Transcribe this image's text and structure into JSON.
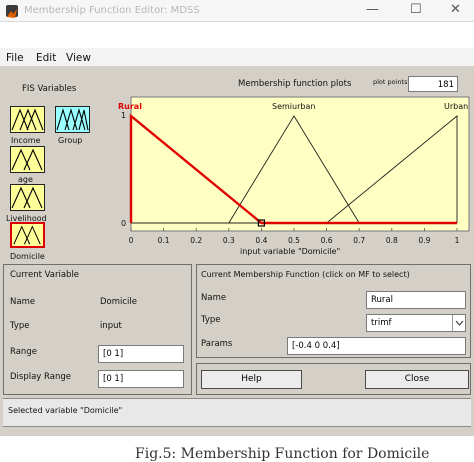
{
  "window": {
    "title": "Membership Function Editor: MDSS",
    "minimize_glyph": "—",
    "maximize_glyph": "☐",
    "close_glyph": "✕"
  },
  "menu": {
    "file": "File",
    "edit": "Edit",
    "view": "View"
  },
  "fis_variables": {
    "heading": "FIS Variables",
    "inputs": [
      "Income",
      "age",
      "Livelihood",
      "Domicile"
    ],
    "output": "Group"
  },
  "plot": {
    "heading": "Membership function plots",
    "plot_points_label": "plot points",
    "plot_points_value": "181",
    "xlabel": "input variable \"Domicile\"",
    "y_top_label": "1",
    "y_bottom_label": "0",
    "x_tick_labels": [
      "0",
      "0.1",
      "0.2",
      "0.3",
      "0.4",
      "0.5",
      "0.6",
      "0.7",
      "0.8",
      "0.9",
      "1"
    ]
  },
  "chart_data": {
    "type": "line",
    "xlabel": "input variable \"Domicile\"",
    "xlim": [
      0,
      1
    ],
    "ylim": [
      0,
      1
    ],
    "grid": false,
    "series": [
      {
        "name": "Rural",
        "x": [
          0,
          0,
          0.4,
          1
        ],
        "y": [
          0,
          1,
          0,
          0
        ],
        "color": "#e00000",
        "selected": true
      },
      {
        "name": "Semiurban",
        "x": [
          0,
          0.3,
          0.5,
          0.7,
          1
        ],
        "y": [
          0,
          0,
          1,
          0,
          0
        ],
        "color": "#222222",
        "selected": false
      },
      {
        "name": "Urban",
        "x": [
          0,
          0.6,
          1,
          1
        ],
        "y": [
          0,
          0,
          1,
          0
        ],
        "color": "#222222",
        "selected": false
      }
    ]
  },
  "current_variable": {
    "heading": "Current Variable",
    "name_label": "Name",
    "name_value": "Domicile",
    "type_label": "Type",
    "type_value": "input",
    "range_label": "Range",
    "range_value": "[0 1]",
    "display_range_label": "Display Range",
    "display_range_value": "[0 1]"
  },
  "current_mf": {
    "heading": "Current Membership Function (click on MF to select)",
    "name_label": "Name",
    "name_value": "Rural",
    "type_label": "Type",
    "type_value": "trimf",
    "params_label": "Params",
    "params_value": "[-0.4 0 0.4]"
  },
  "buttons": {
    "help": "Help",
    "close": "Close"
  },
  "status": {
    "text": "Selected variable \"Domicile\""
  },
  "caption": {
    "text": "Fig.5: Membership Function for Domicile"
  }
}
